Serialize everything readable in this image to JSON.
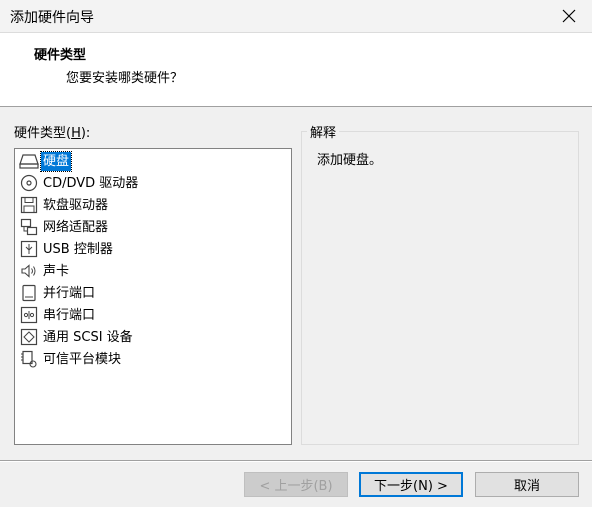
{
  "window": {
    "title": "添加硬件向导",
    "close_icon": "close-icon"
  },
  "header": {
    "title": "硬件类型",
    "subtitle": "您要安装哪类硬件？"
  },
  "hardware_list": {
    "label_prefix": "硬件类型(",
    "label_mnemonic": "H",
    "label_suffix": "):",
    "selected_index": 0,
    "items": [
      {
        "label": "硬盘",
        "icon": "hard-disk-icon"
      },
      {
        "label": "CD/DVD 驱动器",
        "icon": "cd-dvd-icon"
      },
      {
        "label": "软盘驱动器",
        "icon": "floppy-icon"
      },
      {
        "label": "网络适配器",
        "icon": "network-adapter-icon"
      },
      {
        "label": "USB 控制器",
        "icon": "usb-icon"
      },
      {
        "label": "声卡",
        "icon": "sound-card-icon"
      },
      {
        "label": "并行端口",
        "icon": "parallel-port-icon"
      },
      {
        "label": "串行端口",
        "icon": "serial-port-icon"
      },
      {
        "label": "通用 SCSI 设备",
        "icon": "scsi-icon"
      },
      {
        "label": "可信平台模块",
        "icon": "tpm-icon"
      }
    ]
  },
  "explanation": {
    "title": "解释",
    "text": "添加硬盘。"
  },
  "buttons": {
    "back_label": "< 上一步(B)",
    "next_label": "下一步(N) >",
    "cancel_label": "取消"
  },
  "colors": {
    "selection": "#0078d7",
    "default_button_border": "#0078d7"
  }
}
